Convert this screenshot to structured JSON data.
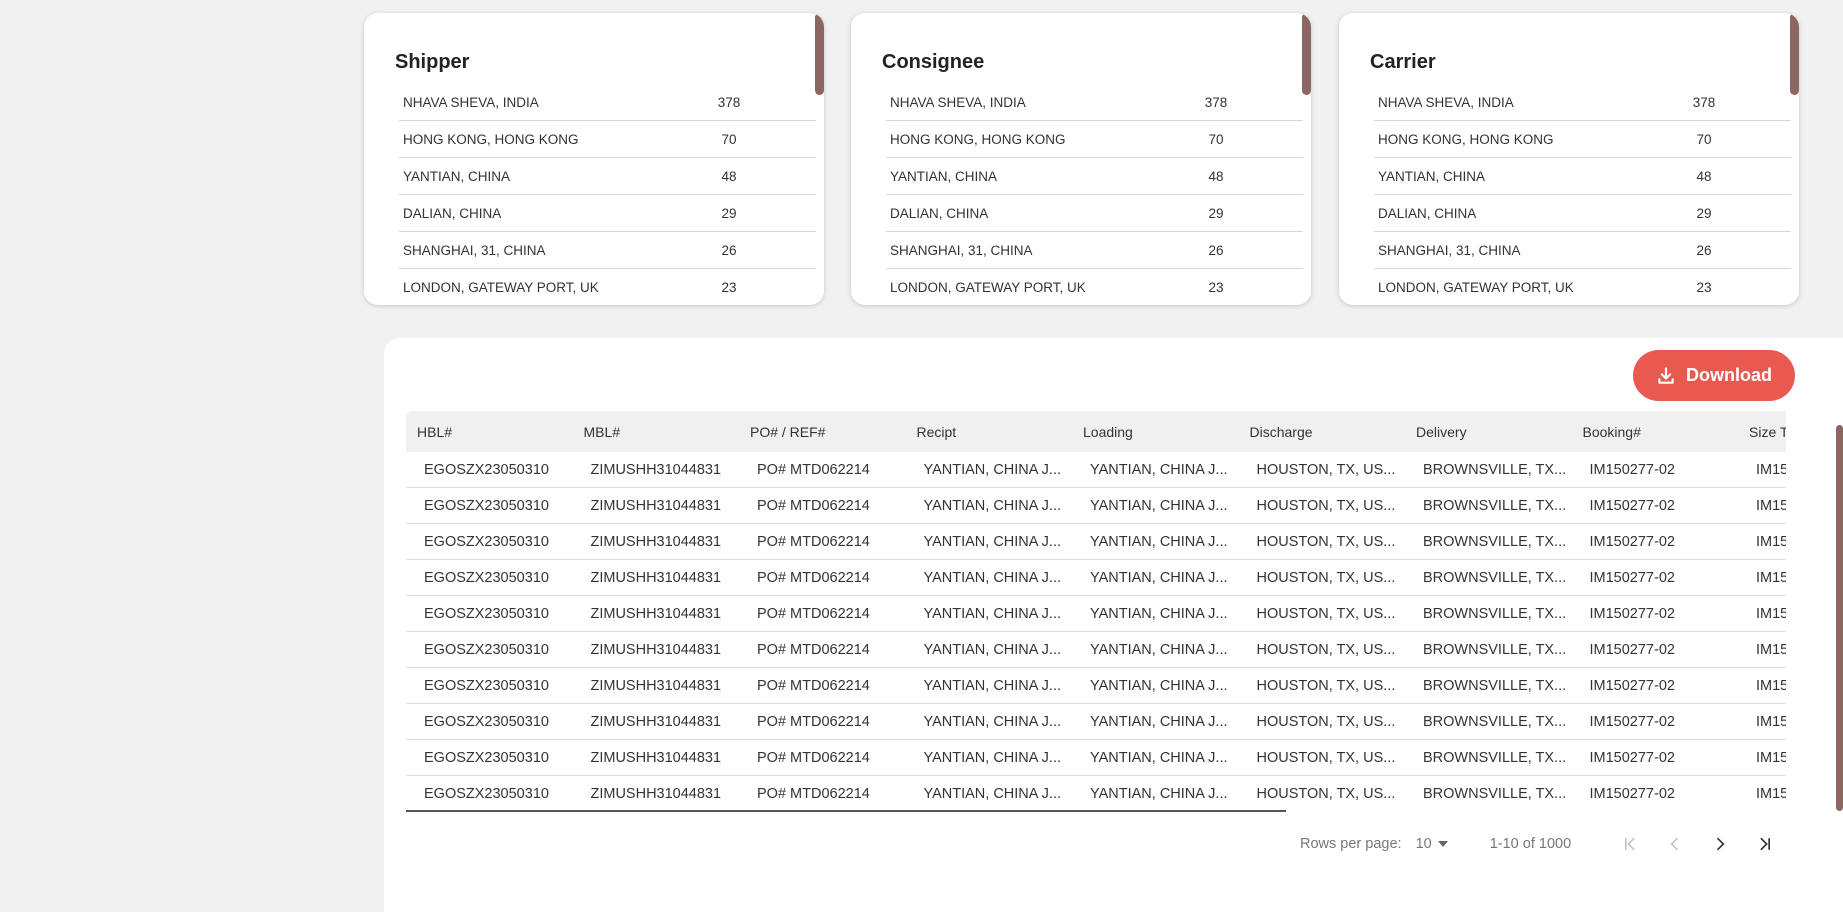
{
  "cards": [
    {
      "title": "Shipper",
      "rows": [
        {
          "name": "NHAVA SHEVA, INDIA",
          "count": "378"
        },
        {
          "name": "HONG KONG, HONG KONG",
          "count": "70"
        },
        {
          "name": "YANTIAN, CHINA",
          "count": "48"
        },
        {
          "name": "DALIAN, CHINA",
          "count": "29"
        },
        {
          "name": "SHANGHAI, 31, CHINA",
          "count": "26"
        },
        {
          "name": "LONDON, GATEWAY PORT, UK",
          "count": "23"
        }
      ]
    },
    {
      "title": "Consignee",
      "rows": [
        {
          "name": "NHAVA SHEVA, INDIA",
          "count": "378"
        },
        {
          "name": "HONG KONG, HONG KONG",
          "count": "70"
        },
        {
          "name": "YANTIAN, CHINA",
          "count": "48"
        },
        {
          "name": "DALIAN, CHINA",
          "count": "29"
        },
        {
          "name": "SHANGHAI, 31, CHINA",
          "count": "26"
        },
        {
          "name": "LONDON, GATEWAY PORT, UK",
          "count": "23"
        }
      ]
    },
    {
      "title": "Carrier",
      "rows": [
        {
          "name": "NHAVA SHEVA, INDIA",
          "count": "378"
        },
        {
          "name": "HONG KONG, HONG KONG",
          "count": "70"
        },
        {
          "name": "YANTIAN, CHINA",
          "count": "48"
        },
        {
          "name": "DALIAN, CHINA",
          "count": "29"
        },
        {
          "name": "SHANGHAI, 31, CHINA",
          "count": "26"
        },
        {
          "name": "LONDON, GATEWAY PORT, UK",
          "count": "23"
        }
      ]
    }
  ],
  "download": {
    "label": "Download",
    "icon": "download-icon",
    "color": "#e85a4f"
  },
  "table": {
    "headers": [
      "HBL#",
      "MBL#",
      "PO# / REF#",
      "Recipt",
      "Loading",
      "Discharge",
      "Delivery",
      "Booking#",
      "Size Ty"
    ],
    "rows": [
      [
        "EGOSZX23050310",
        "ZIMUSHH31044831",
        "PO# MTD062214",
        "YANTIAN, CHINA J...",
        "YANTIAN, CHINA J...",
        "HOUSTON, TX, US...",
        "BROWNSVILLE, TX...",
        "IM150277-02",
        "IM15"
      ],
      [
        "EGOSZX23050310",
        "ZIMUSHH31044831",
        "PO# MTD062214",
        "YANTIAN, CHINA J...",
        "YANTIAN, CHINA J...",
        "HOUSTON, TX, US...",
        "BROWNSVILLE, TX...",
        "IM150277-02",
        "IM15"
      ],
      [
        "EGOSZX23050310",
        "ZIMUSHH31044831",
        "PO# MTD062214",
        "YANTIAN, CHINA J...",
        "YANTIAN, CHINA J...",
        "HOUSTON, TX, US...",
        "BROWNSVILLE, TX...",
        "IM150277-02",
        "IM15"
      ],
      [
        "EGOSZX23050310",
        "ZIMUSHH31044831",
        "PO# MTD062214",
        "YANTIAN, CHINA J...",
        "YANTIAN, CHINA J...",
        "HOUSTON, TX, US...",
        "BROWNSVILLE, TX...",
        "IM150277-02",
        "IM15"
      ],
      [
        "EGOSZX23050310",
        "ZIMUSHH31044831",
        "PO# MTD062214",
        "YANTIAN, CHINA J...",
        "YANTIAN, CHINA J...",
        "HOUSTON, TX, US...",
        "BROWNSVILLE, TX...",
        "IM150277-02",
        "IM15"
      ],
      [
        "EGOSZX23050310",
        "ZIMUSHH31044831",
        "PO# MTD062214",
        "YANTIAN, CHINA J...",
        "YANTIAN, CHINA J...",
        "HOUSTON, TX, US...",
        "BROWNSVILLE, TX...",
        "IM150277-02",
        "IM15"
      ],
      [
        "EGOSZX23050310",
        "ZIMUSHH31044831",
        "PO# MTD062214",
        "YANTIAN, CHINA J...",
        "YANTIAN, CHINA J...",
        "HOUSTON, TX, US...",
        "BROWNSVILLE, TX...",
        "IM150277-02",
        "IM15"
      ],
      [
        "EGOSZX23050310",
        "ZIMUSHH31044831",
        "PO# MTD062214",
        "YANTIAN, CHINA J...",
        "YANTIAN, CHINA J...",
        "HOUSTON, TX, US...",
        "BROWNSVILLE, TX...",
        "IM150277-02",
        "IM15"
      ],
      [
        "EGOSZX23050310",
        "ZIMUSHH31044831",
        "PO# MTD062214",
        "YANTIAN, CHINA J...",
        "YANTIAN, CHINA J...",
        "HOUSTON, TX, US...",
        "BROWNSVILLE, TX...",
        "IM150277-02",
        "IM15"
      ],
      [
        "EGOSZX23050310",
        "ZIMUSHH31044831",
        "PO# MTD062214",
        "YANTIAN, CHINA J...",
        "YANTIAN, CHINA J...",
        "HOUSTON, TX, US...",
        "BROWNSVILLE, TX...",
        "IM150277-02",
        "IM15"
      ]
    ]
  },
  "pagination": {
    "rows_per_page_label": "Rows per page:",
    "rows_per_page_value": "10",
    "range": "1-10 of 1000",
    "icons": [
      "first-page-icon",
      "previous-page-icon",
      "next-page-icon",
      "last-page-icon"
    ]
  },
  "colors": {
    "accent": "#e85a4f",
    "scrollbar": "#8b6762",
    "background": "#f1f1f1"
  }
}
